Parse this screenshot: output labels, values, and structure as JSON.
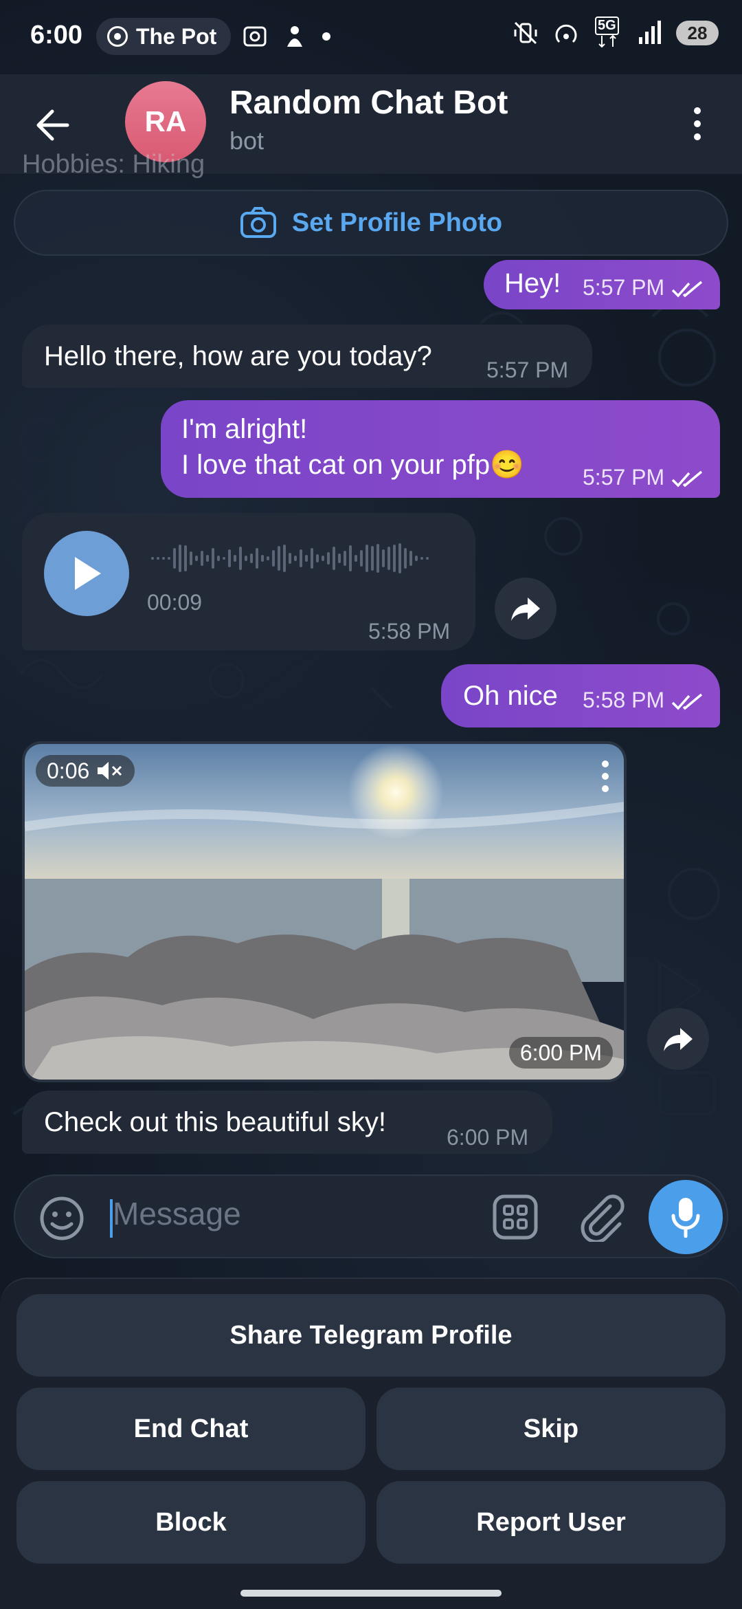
{
  "status_bar": {
    "time": "6:00",
    "media_pill": "The Pot",
    "battery": "28",
    "network": "5G"
  },
  "header": {
    "avatar_initials": "RA",
    "title": "Random Chat Bot",
    "subtitle": "bot"
  },
  "profile_card": {
    "faded_text": "Hobbies: Hiking",
    "set_photo_label": "Set Profile Photo"
  },
  "messages": [
    {
      "dir": "out",
      "text": "Hey!",
      "time": "5:57 PM"
    },
    {
      "dir": "in",
      "text": "Hello there, how are you today?",
      "time": "5:57 PM"
    },
    {
      "dir": "out",
      "line1": "I'm alright!",
      "line2": "I love that cat on your pfp😊",
      "time": "5:57 PM"
    },
    {
      "dir": "in",
      "type": "voice",
      "duration": "00:09",
      "time": "5:58 PM"
    },
    {
      "dir": "out",
      "text": "Oh nice",
      "time": "5:58 PM"
    },
    {
      "dir": "in",
      "type": "video",
      "duration": "0:06",
      "time": "6:00 PM"
    },
    {
      "dir": "in",
      "text": "Check out this beautiful sky!",
      "time": "6:00 PM"
    }
  ],
  "input": {
    "placeholder": "Message"
  },
  "keyboard": {
    "share_profile": "Share Telegram Profile",
    "end_chat": "End Chat",
    "skip": "Skip",
    "block": "Block",
    "report_user": "Report User"
  },
  "colors": {
    "outgoing": "#8048c8",
    "incoming": "#222a37",
    "accent": "#4b9eea"
  }
}
